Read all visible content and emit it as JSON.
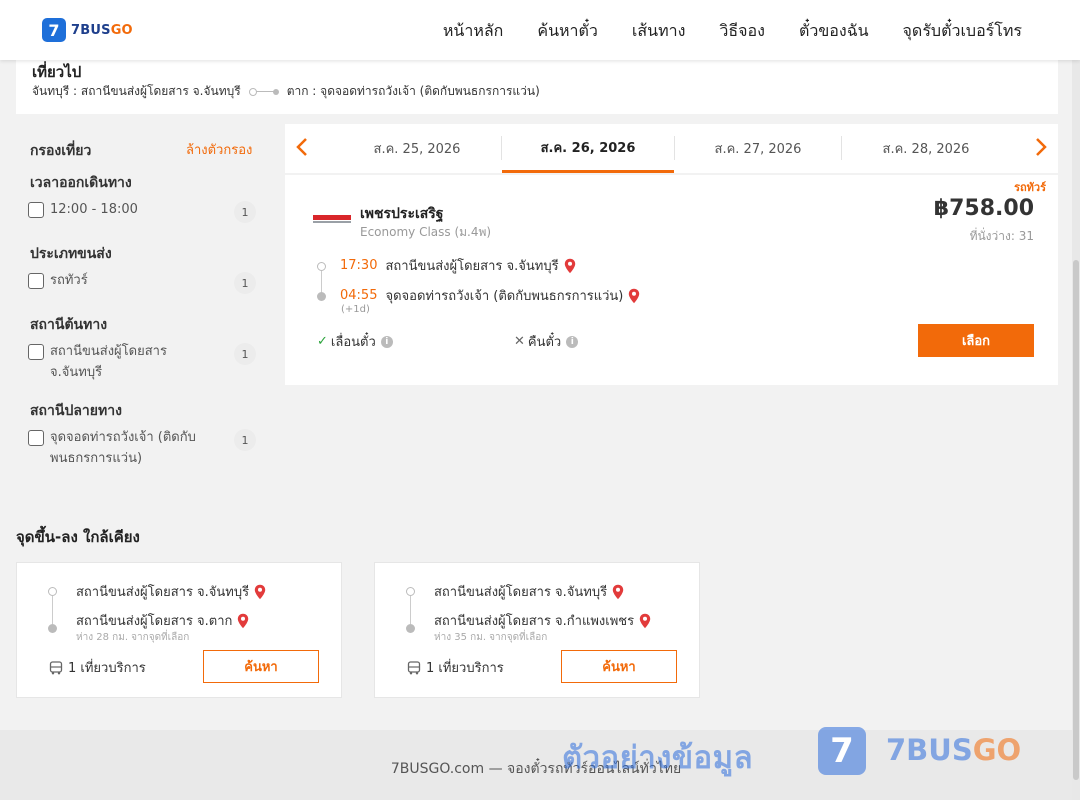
{
  "brand": {
    "logo_digit": "7",
    "logo_text_a": "7BUS",
    "logo_text_b": "GO"
  },
  "nav": [
    "หน้าหลัก",
    "ค้นหาตั๋ว",
    "เส้นทาง",
    "วิธีจอง",
    "ตั๋วของฉัน",
    "จุดรับตั๋วเบอร์โทร"
  ],
  "trip": {
    "title": "เที่ยวไป",
    "origin": "จันทบุรี : สถานีขนส่งผู้โดยสาร จ.จันทบุรี",
    "destination": "ตาก : จุดจอดท่ารถวังเจ้า (ติดกับพนธกรการแว่น)"
  },
  "filters": {
    "title": "กรองเที่ยว",
    "clear": "ล้างตัวกรอง",
    "sections": [
      {
        "title": "เวลาออกเดินทาง",
        "label": "12:00 - 18:00",
        "count": "1"
      },
      {
        "title": "ประเภทขนส่ง",
        "label": "รถทัวร์",
        "count": "1"
      },
      {
        "title": "สถานีต้นทาง",
        "label": "สถานีขนส่งผู้โดยสาร จ.จันทบุรี",
        "count": "1"
      },
      {
        "title": "สถานีปลายทาง",
        "label": "จุดจอดท่ารถวังเจ้า (ติดกับพนธกรการแว่น)",
        "count": "1"
      }
    ]
  },
  "dates": {
    "tabs": [
      "ส.ค. 25, 2026",
      "ส.ค. 26, 2026",
      "ส.ค. 27, 2026",
      "ส.ค. 28, 2026"
    ],
    "active_index": 1
  },
  "result": {
    "type_badge": "รถทัวร์",
    "operator": "เพชรประเสริฐ",
    "operator_logo_text": "เพชรประเสริฐ",
    "class": "Economy Class (ม.4พ)",
    "price": "฿758.00",
    "seats": "ที่นั่งว่าง: 31",
    "depart_time": "17:30",
    "depart_station": "สถานีขนส่งผู้โดยสาร จ.จันทบุรี",
    "arrive_time": "04:55",
    "arrive_station": "จุดจอดท่ารถวังเจ้า (ติดกับพนธกรการแว่น)",
    "next_day": "(+1d)",
    "reschedule": "เลื่อนตั๋ว",
    "refund": "คืนตั๋ว",
    "select_label": "เลือก"
  },
  "nearby": {
    "title": "จุดขึ้น-ลง ใกล้เคียง",
    "cards": [
      {
        "from": "สถานีขนส่งผู้โดยสาร จ.จันทบุรี",
        "to": "สถานีขนส่งผู้โดยสาร จ.ตาก",
        "distance": "ห่าง 28 กม. จากจุดที่เลือก",
        "trips": "1 เที่ยวบริการ",
        "button": "ค้นหา"
      },
      {
        "from": "สถานีขนส่งผู้โดยสาร จ.จันทบุรี",
        "to": "สถานีขนส่งผู้โดยสาร จ.กำแพงเพชร",
        "distance": "ห่าง 35 กม. จากจุดที่เลือก",
        "trips": "1 เที่ยวบริการ",
        "button": "ค้นหา"
      }
    ]
  },
  "footer": {
    "text": "7BUSGO.com — จองตั๋วรถทัวร์ออนไลน์ทั่วไทย"
  },
  "watermark": {
    "text": "ตัวอย่างข้อมูล",
    "logo_digit": "7",
    "brand_a": "7BUS",
    "brand_b": "GO"
  },
  "colors": {
    "accent": "#f26a0a",
    "brand_blue": "#1e6fd9",
    "pin_red": "#e23b3b"
  },
  "icons": [
    "chevron-left-icon",
    "chevron-right-icon",
    "map-pin-icon",
    "check-icon",
    "cross-icon",
    "info-icon",
    "bus-icon"
  ]
}
